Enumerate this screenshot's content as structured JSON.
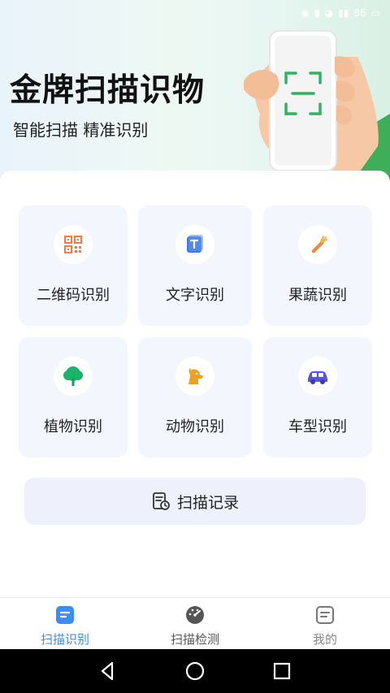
{
  "status_bar": {
    "icons": [
      "location-icon",
      "vibrate-icon",
      "wifi-icon",
      "signal-icon",
      "battery-icon"
    ],
    "text": "86"
  },
  "banner": {
    "title": "金牌扫描识物",
    "subtitle": "智能扫描 精准识别"
  },
  "tiles": [
    {
      "label": "二维码识别",
      "icon": "qr-code-icon",
      "color": "#f07b4a"
    },
    {
      "label": "文字识别",
      "icon": "text-icon",
      "color": "#3d7be8"
    },
    {
      "label": "果蔬识别",
      "icon": "carrot-icon",
      "color": "#f08a3a"
    },
    {
      "label": "植物识别",
      "icon": "tree-icon",
      "color": "#1bb36a"
    },
    {
      "label": "动物识别",
      "icon": "dog-icon",
      "color": "#f0a020"
    },
    {
      "label": "车型识别",
      "icon": "car-icon",
      "color": "#5a55d8"
    }
  ],
  "record_button": {
    "label": "扫描记录",
    "icon": "history-doc-icon"
  },
  "tabbar": {
    "tabs": [
      {
        "label": "扫描识别",
        "active": true,
        "color": "#3a8ef0"
      },
      {
        "label": "扫描检测",
        "active": false,
        "color": "#555555"
      },
      {
        "label": "我的",
        "active": false,
        "color": "#888888"
      }
    ]
  },
  "nav": {
    "back": "back-icon",
    "home": "home-icon",
    "recents": "recents-icon"
  }
}
